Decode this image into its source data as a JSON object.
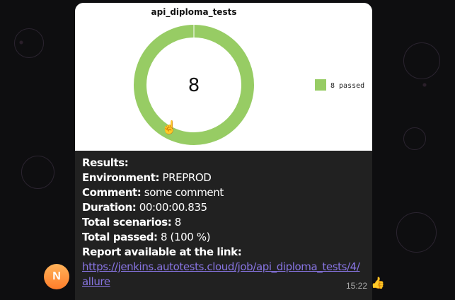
{
  "chat": {
    "avatar_initial": "N",
    "avatar_color": "#ff8c3a",
    "time": "15:22",
    "reaction": "👍"
  },
  "message": {
    "results_label": "Results:",
    "environment_label": "Environment:",
    "environment_value": "PREPROD",
    "comment_label": "Comment:",
    "comment_value": "some comment",
    "duration_label": "Duration:",
    "duration_value": "00:00:00.835",
    "scenarios_label": "Total scenarios:",
    "scenarios_value": "8",
    "passed_label": "Total passed:",
    "passed_value": "8 (100 %)",
    "report_label": "Report available at the link:",
    "report_link": "https://jenkins.autotests.cloud/job/api_diploma_tests/4/allure",
    "link_color": "#8774e1"
  },
  "chart_data": {
    "type": "pie",
    "title": "api_diploma_tests",
    "center_label": "8",
    "categories": [
      "8 passed"
    ],
    "values": [
      8
    ],
    "colors": [
      "#97cc64"
    ],
    "legend_position": "right"
  }
}
